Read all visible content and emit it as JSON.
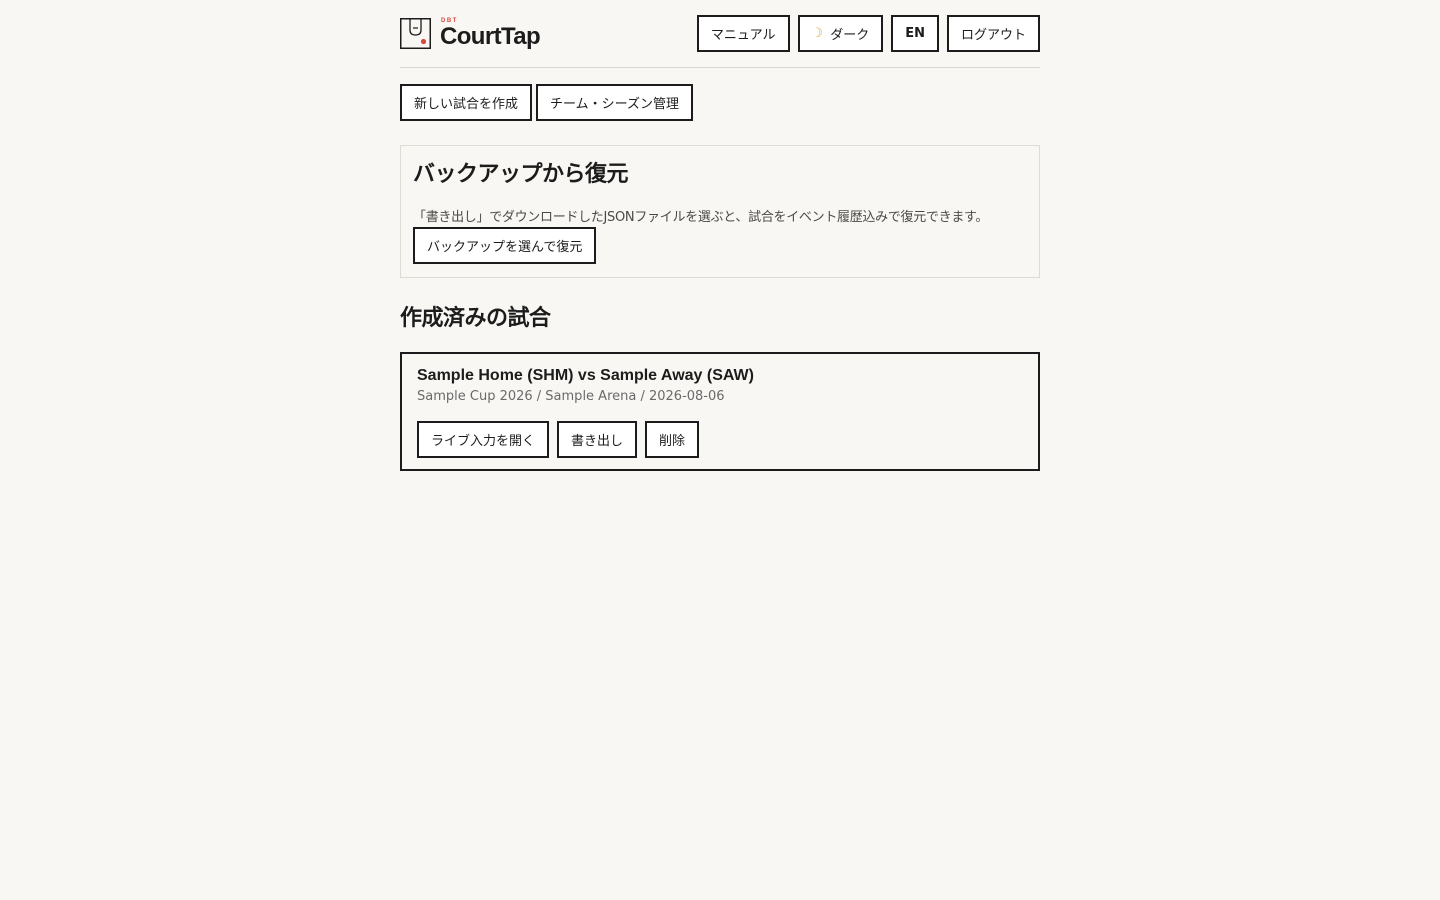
{
  "brand": {
    "tag": "DBT",
    "name": "CourtTap"
  },
  "nav": {
    "manual_label": "マニュアル",
    "theme_label": "ダーク",
    "theme_icon": "moon-icon",
    "lang_label": "EN",
    "logout_label": "ログアウト"
  },
  "actions": {
    "new_match_label": "新しい試合を作成",
    "team_season_label": "チーム・シーズン管理"
  },
  "restore": {
    "title": "バックアップから復元",
    "description": "「書き出し」でダウンロードしたJSONファイルを選ぶと、試合をイベント履歴込みで復元できます。",
    "button_label": "バックアップを選んで復元"
  },
  "matches": {
    "section_title": "作成済みの試合",
    "items": [
      {
        "title": "Sample Home (SHM) vs Sample Away (SAW)",
        "meta": "Sample Cup 2026 / Sample Arena / 2026-08-06",
        "open_label": "ライブ入力を開く",
        "export_label": "書き出し",
        "delete_label": "削除"
      }
    ]
  },
  "colors": {
    "background": "#f8f7f3",
    "text": "#1c1c1c",
    "accent": "#d84a3b",
    "moon": "#e2a53a"
  }
}
